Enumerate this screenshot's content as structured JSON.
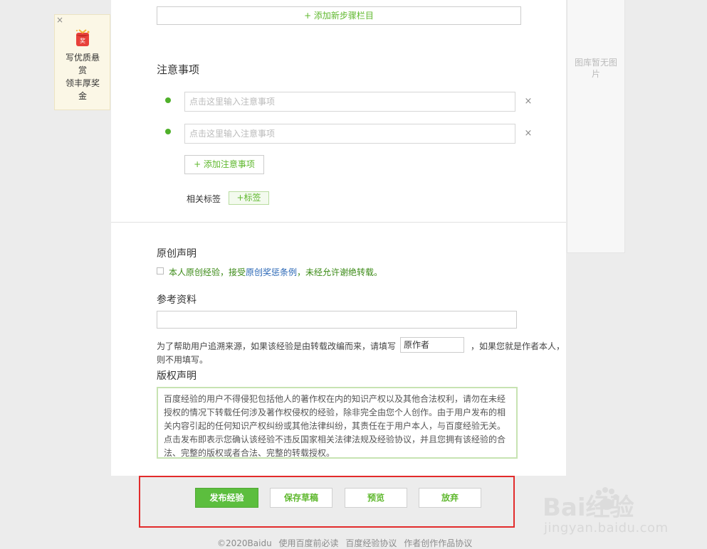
{
  "reward": {
    "close": "×",
    "badge": "奖",
    "line1": "写优质悬",
    "line2": "赏",
    "line3": "领丰厚奖",
    "line4": "金"
  },
  "gallery": {
    "empty_line1": "图库暂无图",
    "empty_line2": "片"
  },
  "steps": {
    "add_label": "+ 添加新步骤栏目"
  },
  "notes": {
    "title": "注意事项",
    "placeholder": "点击这里输入注意事项",
    "remove": "×",
    "add_label": "+ 添加注意事项"
  },
  "tags": {
    "label": "相关标签",
    "add_label": "+标签"
  },
  "original": {
    "title": "原创声明",
    "text_before": "本人原创经验，接受",
    "link": "原创奖惩条例",
    "text_after": "，未经允许谢绝转载。"
  },
  "reference": {
    "title": "参考资料",
    "source_text1": "为了帮助用户追溯来源，如果该经验是由转载改编而来，请填写",
    "author_placeholder": "原作者",
    "source_text2": "，如果您就是作者本人，",
    "source_text3": "则不用填写。"
  },
  "copyright": {
    "title": "版权声明",
    "line1": "百度经验的用户不得侵犯包括他人的著作权在内的知识产权以及其他合法权利，请勿在未经",
    "line2": "授权的情况下转载任何涉及著作权侵权的经验，除非完全由您个人创作。由于用户发布的相",
    "line3": "关内容引起的任何知识产权纠纷或其他法律纠纷，其责任在于用户本人，与百度经验无关。",
    "line4": "点击发布即表示您确认该经验不违反国家相关法律法规及经验协议，并且您拥有该经验的合",
    "line5": "法、完整的版权或者合法、完整的转载授权。"
  },
  "actions": {
    "publish": "发布经验",
    "save_draft": "保存草稿",
    "preview": "预览",
    "abandon": "放弃"
  },
  "footer": {
    "copyright": "©2020Baidu",
    "link1": "使用百度前必读",
    "link2": "百度经验协议",
    "link3": "作者创作作品协议"
  },
  "watermark": {
    "logo": "Bai经验",
    "url": "jingyan.baidu.com"
  },
  "colors": {
    "accent_green": "#5cbe3e",
    "highlight_red": "#e22b2b",
    "link_blue": "#2a67b6"
  }
}
